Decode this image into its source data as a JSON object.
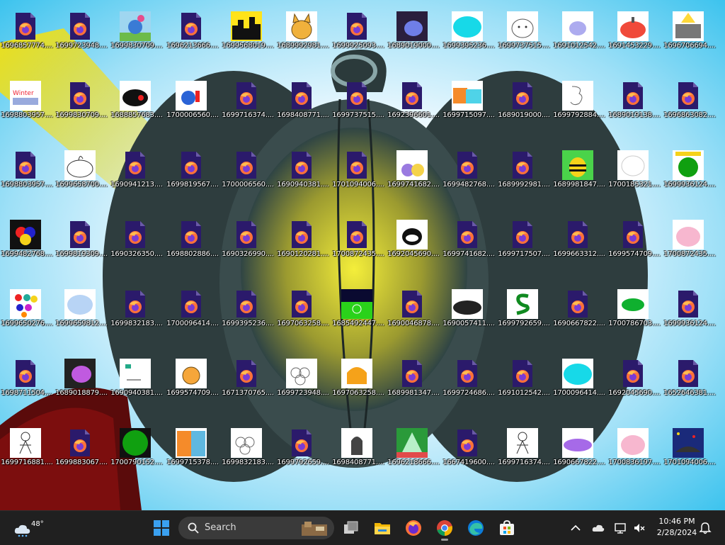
{
  "desktop": {
    "icons": [
      {
        "label": "1696857774....",
        "thumb": "firefox-doc"
      },
      {
        "label": "1699723948....",
        "thumb": "firefox-doc"
      },
      {
        "label": "1699830709....",
        "thumb": "cartoon-blue-bird"
      },
      {
        "label": "1696213666....",
        "thumb": "firefox-doc"
      },
      {
        "label": "1699568019....",
        "thumb": "yellow-city"
      },
      {
        "label": "1689992981....",
        "thumb": "orange-cat"
      },
      {
        "label": "1699925093....",
        "thumb": "firefox-doc"
      },
      {
        "label": "1689019000....",
        "thumb": "blue-blob"
      },
      {
        "label": "1699395236....",
        "thumb": "cyan-blob"
      },
      {
        "label": "1699737515....",
        "thumb": "sketch-face"
      },
      {
        "label": "1691012542....",
        "thumb": "purple-blob"
      },
      {
        "label": "1691453229....",
        "thumb": "red-pumpkin"
      },
      {
        "label": "1696706694....",
        "thumb": "gray-castle"
      },
      {
        "label": "1698803957....",
        "thumb": "winter-text"
      },
      {
        "label": "1699830709....",
        "thumb": "firefox-doc"
      },
      {
        "label": "1688857683....",
        "thumb": "black-red-blob"
      },
      {
        "label": "1700006560....",
        "thumb": "red-blue-toy"
      },
      {
        "label": "1699716374....",
        "thumb": "firefox-doc"
      },
      {
        "label": "1698408771....",
        "thumb": "firefox-doc"
      },
      {
        "label": "1699737515....",
        "thumb": "firefox-doc"
      },
      {
        "label": "1692396601....",
        "thumb": "firefox-doc"
      },
      {
        "label": "1699715097....",
        "thumb": "orange-cyan-blocks"
      },
      {
        "label": "1689019000....",
        "thumb": "firefox-doc"
      },
      {
        "label": "1699792884....",
        "thumb": "sketch-three"
      },
      {
        "label": "1689019138....",
        "thumb": "firefox-doc"
      },
      {
        "label": "1696863082....",
        "thumb": "firefox-doc"
      },
      {
        "label": "1698803957....",
        "thumb": "firefox-doc"
      },
      {
        "label": "1699658700....",
        "thumb": "white-blob-sketch"
      },
      {
        "label": "1690941213....",
        "thumb": "firefox-doc"
      },
      {
        "label": "1699819567....",
        "thumb": "firefox-doc"
      },
      {
        "label": "1700006560....",
        "thumb": "firefox-doc"
      },
      {
        "label": "1690940381....",
        "thumb": "firefox-doc"
      },
      {
        "label": "1701094006....",
        "thumb": "firefox-doc"
      },
      {
        "label": "1699741682....",
        "thumb": "purple-yellow-pair"
      },
      {
        "label": "1699482768....",
        "thumb": "firefox-doc"
      },
      {
        "label": "1689992981....",
        "thumb": "firefox-doc"
      },
      {
        "label": "1689981847....",
        "thumb": "bee-bug"
      },
      {
        "label": "1700185321....",
        "thumb": "white-ghost"
      },
      {
        "label": "1699936124....",
        "thumb": "green-circle"
      },
      {
        "label": "1699482768....",
        "thumb": "rgb-circles"
      },
      {
        "label": "1699819309....",
        "thumb": "firefox-doc"
      },
      {
        "label": "1690326350....",
        "thumb": "firefox-doc"
      },
      {
        "label": "1698802886....",
        "thumb": "firefox-doc"
      },
      {
        "label": "1690326990....",
        "thumb": "firefox-doc"
      },
      {
        "label": "1690120281....",
        "thumb": "firefox-doc"
      },
      {
        "label": "1700872435....",
        "thumb": "firefox-doc"
      },
      {
        "label": "1692045690....",
        "thumb": "black-white-face"
      },
      {
        "label": "1699741682....",
        "thumb": "firefox-doc"
      },
      {
        "label": "1699717507....",
        "thumb": "firefox-doc"
      },
      {
        "label": "1699663312....",
        "thumb": "firefox-doc"
      },
      {
        "label": "1699574709....",
        "thumb": "firefox-doc"
      },
      {
        "label": "1700872435....",
        "thumb": "pink-pumpkin"
      },
      {
        "label": "1699650276....",
        "thumb": "color-dots"
      },
      {
        "label": "1699659812....",
        "thumb": "light-blue-blob"
      },
      {
        "label": "1699832183....",
        "thumb": "firefox-doc"
      },
      {
        "label": "1700096414....",
        "thumb": "firefox-doc"
      },
      {
        "label": "1699395236....",
        "thumb": "firefox-doc"
      },
      {
        "label": "1697063258....",
        "thumb": "firefox-doc"
      },
      {
        "label": "1685492447....",
        "thumb": "green-field"
      },
      {
        "label": "1690046878....",
        "thumb": "firefox-doc"
      },
      {
        "label": "1690057411....",
        "thumb": "black-blob"
      },
      {
        "label": "1699792659....",
        "thumb": "green-s"
      },
      {
        "label": "1690667822....",
        "thumb": "firefox-doc"
      },
      {
        "label": "1700786703....",
        "thumb": "green-turtle"
      },
      {
        "label": "1699936124....",
        "thumb": "firefox-doc"
      },
      {
        "label": "1698711504....",
        "thumb": "firefox-doc"
      },
      {
        "label": "1689018879....",
        "thumb": "purple-creature"
      },
      {
        "label": "1690940381....",
        "thumb": "white-sketch-small"
      },
      {
        "label": "1699574709....",
        "thumb": "orange-pumpkin"
      },
      {
        "label": "1671370765....",
        "thumb": "firefox-doc"
      },
      {
        "label": "1699723948....",
        "thumb": "sketch-blobs"
      },
      {
        "label": "1697063258....",
        "thumb": "orange-ghost"
      },
      {
        "label": "1689981347....",
        "thumb": "firefox-doc"
      },
      {
        "label": "1699724686....",
        "thumb": "firefox-doc"
      },
      {
        "label": "1691012542....",
        "thumb": "firefox-doc"
      },
      {
        "label": "1700096414....",
        "thumb": "cyan-blob"
      },
      {
        "label": "1692045690....",
        "thumb": "firefox-doc"
      },
      {
        "label": "1652646381....",
        "thumb": "firefox-doc"
      },
      {
        "label": "1699716881....",
        "thumb": "sketch-figure"
      },
      {
        "label": "1699883067....",
        "thumb": "firefox-doc"
      },
      {
        "label": "1700790152....",
        "thumb": "green-square-circle"
      },
      {
        "label": "1699715378....",
        "thumb": "orange-blue-blocks"
      },
      {
        "label": "1699832183....",
        "thumb": "sketch-blobs"
      },
      {
        "label": "1699792659....",
        "thumb": "firefox-doc"
      },
      {
        "label": "1698408771....",
        "thumb": "dark-figure"
      },
      {
        "label": "1696218666....",
        "thumb": "green-cone"
      },
      {
        "label": "1667419600....",
        "thumb": "firefox-doc"
      },
      {
        "label": "1699716374....",
        "thumb": "sketch-figure"
      },
      {
        "label": "1690667822....",
        "thumb": "purple-worm"
      },
      {
        "label": "1700836197....",
        "thumb": "pink-pumpkin"
      },
      {
        "label": "1701094006....",
        "thumb": "space-scene"
      }
    ]
  },
  "taskbar": {
    "weather_temp": "48°",
    "search_placeholder": "Search",
    "apps": [
      {
        "name": "start-button",
        "icon": "windows-icon"
      },
      {
        "name": "task-view-button",
        "icon": "task-view-icon"
      },
      {
        "name": "file-explorer-button",
        "icon": "folder-icon"
      },
      {
        "name": "firefox-button",
        "icon": "firefox-icon"
      },
      {
        "name": "chrome-button",
        "icon": "chrome-icon"
      },
      {
        "name": "edge-button",
        "icon": "edge-icon"
      },
      {
        "name": "store-button",
        "icon": "store-icon"
      }
    ],
    "clock_time": "10:46 PM",
    "clock_date": "2/28/2024"
  },
  "colors": {
    "taskbar_bg": "#202020",
    "accent": "#0078d4",
    "firefox_purple": "#2b1a6b",
    "firefox_orange": "#ff7139"
  }
}
